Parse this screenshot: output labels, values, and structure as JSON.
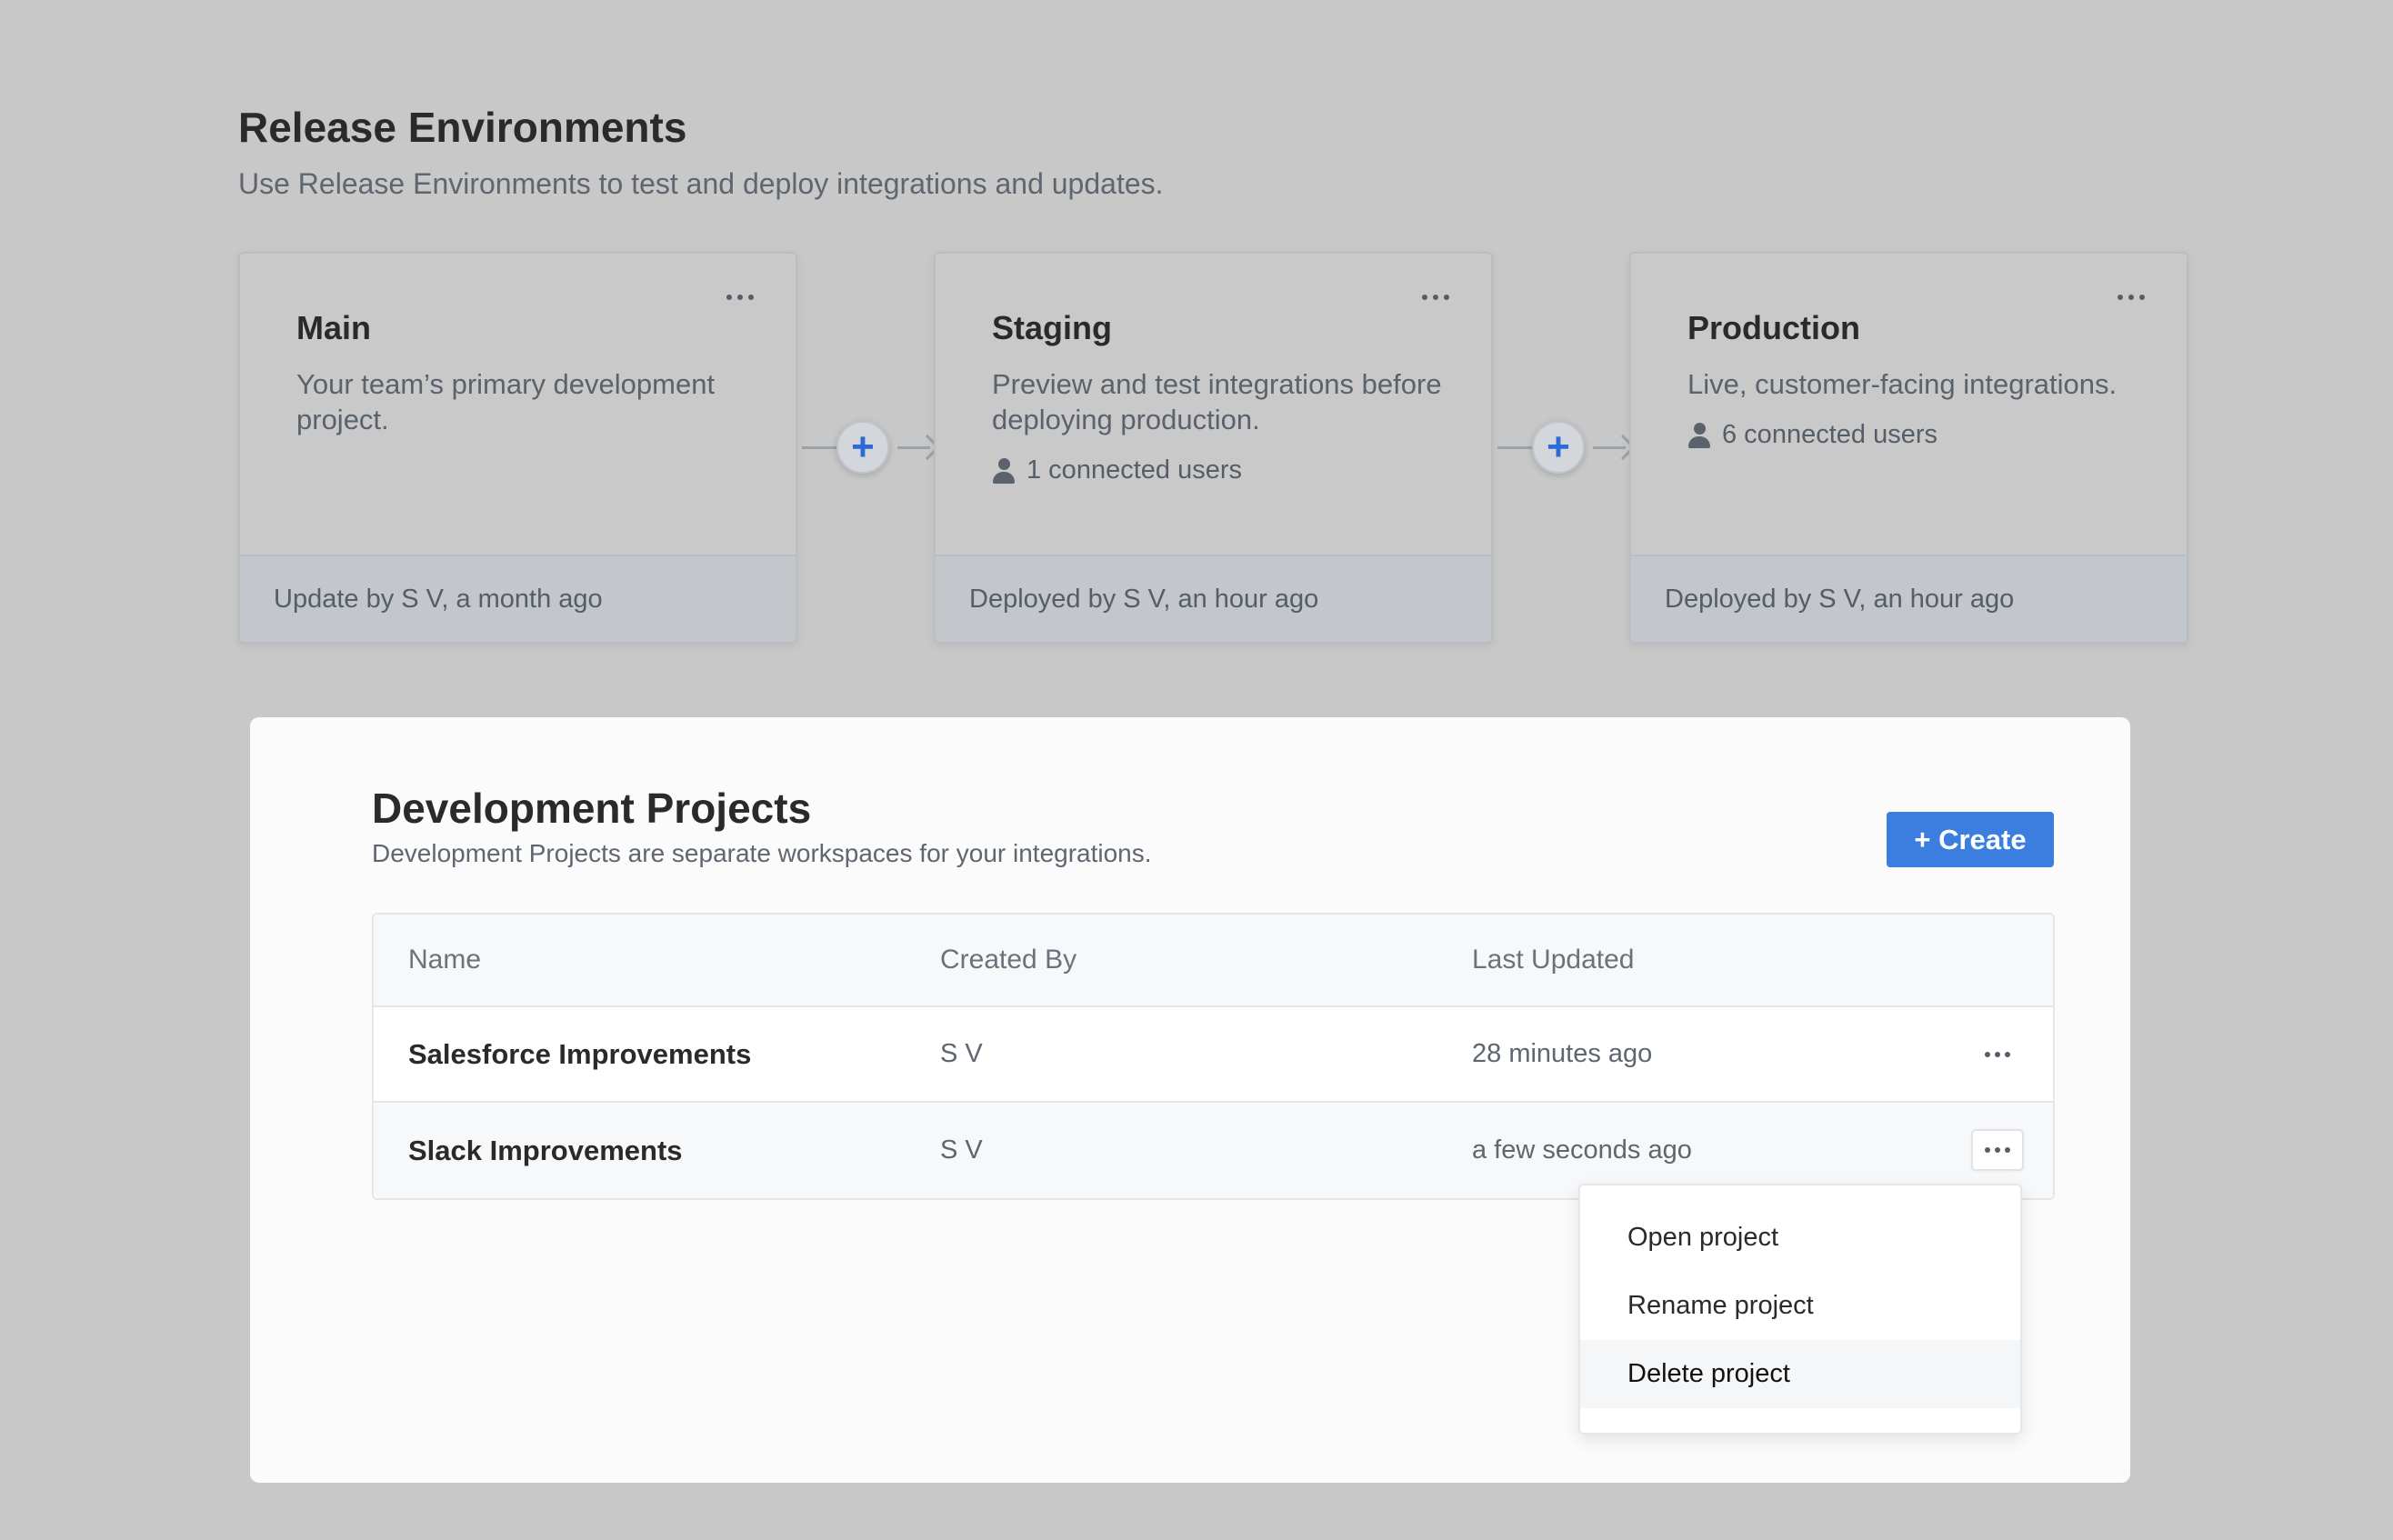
{
  "release": {
    "title": "Release Environments",
    "subtitle": "Use Release Environments to test and deploy integrations and updates.",
    "environments": [
      {
        "name": "Main",
        "description": "Your team’s primary development project.",
        "users": "",
        "footer": "Update by S V, a month ago"
      },
      {
        "name": "Staging",
        "description": "Preview and test integrations before deploying production.",
        "users": "1 connected users",
        "footer": "Deployed by S V, an hour ago"
      },
      {
        "name": "Production",
        "description": "Live, customer-facing integrations.",
        "users": "6 connected users",
        "footer": "Deployed by S V, an hour ago"
      }
    ],
    "connector_glyph": "+"
  },
  "dev": {
    "title": "Development Projects",
    "subtitle": "Development Projects are separate workspaces for your integrations.",
    "create_label": "+ Create",
    "columns": [
      "Name",
      "Created By",
      "Last Updated"
    ],
    "rows": [
      {
        "name": "Salesforce Improvements",
        "created_by": "S V",
        "updated": "28 minutes ago"
      },
      {
        "name": "Slack Improvements",
        "created_by": "S V",
        "updated": "a few seconds ago"
      }
    ],
    "menu": [
      "Open project",
      "Rename project",
      "Delete project"
    ]
  },
  "colors": {
    "accent": "#3b7ee0",
    "plus": "#2d6ad8",
    "backdrop": "#c8c8c8"
  }
}
